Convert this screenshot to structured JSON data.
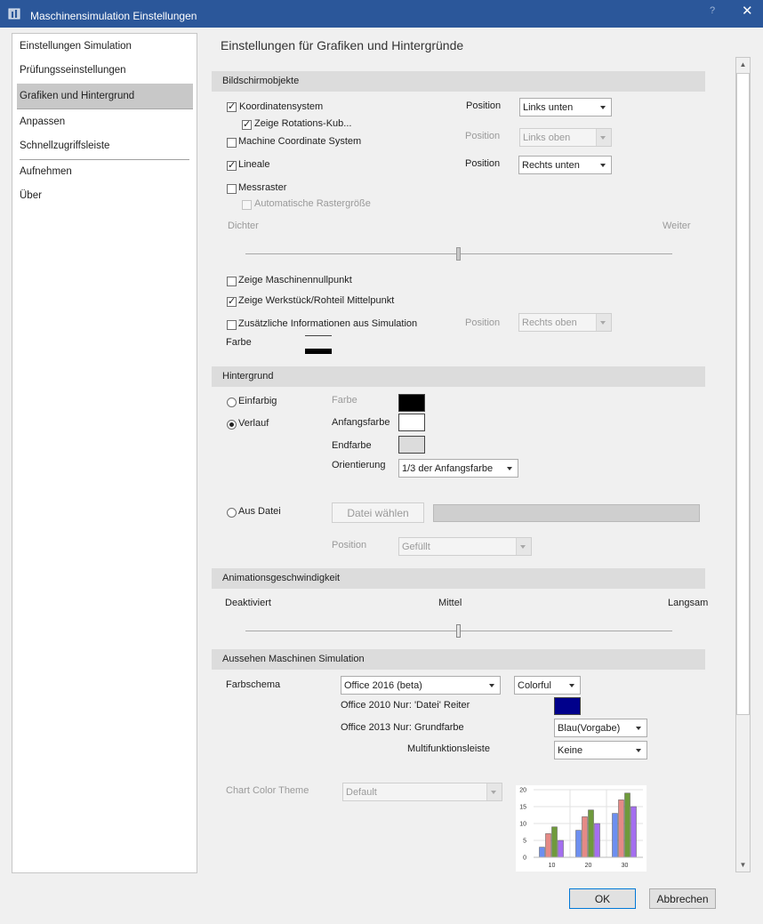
{
  "window": {
    "title": "Maschinensimulation Einstellungen",
    "help_label": "?",
    "close_label": "✕"
  },
  "nav": {
    "items": [
      {
        "label": "Einstellungen Simulation"
      },
      {
        "label": "Prüfungsseinstellungen"
      },
      {
        "label": "Grafiken und Hintergrund",
        "selected": true
      },
      {
        "label": "Anpassen"
      },
      {
        "label": "Schnellzugriffsleiste"
      },
      {
        "label": "Aufnehmen"
      },
      {
        "label": "Über"
      }
    ]
  },
  "page_title": "Einstellungen für Grafiken und Hintergründe",
  "bildschirm": {
    "header": "Bildschirmobjekte",
    "koordinatensystem": {
      "label": "Koordinatensystem",
      "checked": true,
      "position_label": "Position",
      "position_value": "Links unten"
    },
    "rotations": {
      "label": "Zeige Rotations-Kub...",
      "checked": true
    },
    "machine_coord": {
      "label": "Machine Coordinate System",
      "checked": false,
      "position_label": "Position",
      "position_value": "Links oben"
    },
    "lineale": {
      "label": "Lineale",
      "checked": true,
      "position_label": "Position",
      "position_value": "Rechts unten"
    },
    "messraster": {
      "label": "Messraster",
      "checked": false
    },
    "auto_raster": {
      "label": "Automatische Rastergröße",
      "checked": false
    },
    "slider_left": "Dichter",
    "slider_right": "Weiter",
    "maschinennull": {
      "label": "Zeige Maschinennullpunkt",
      "checked": false
    },
    "werkstueck": {
      "label": "Zeige Werkstück/Rohteil Mittelpunkt",
      "checked": true
    },
    "zusatz": {
      "label": "Zusätzliche Informationen aus Simulation",
      "checked": false,
      "position_label": "Position",
      "position_value": "Rechts oben"
    },
    "farbe_label": "Farbe"
  },
  "hintergrund": {
    "header": "Hintergrund",
    "einfarbig": {
      "label": "Einfarbig",
      "selected": false
    },
    "verlauf": {
      "label": "Verlauf",
      "selected": true
    },
    "farbe_label": "Farbe",
    "farbe_color": "#000000",
    "anfangsfarbe_label": "Anfangsfarbe",
    "anfangsfarbe_color": "#ffffff",
    "endfarbe_label": "Endfarbe",
    "endfarbe_color": "#dcdcdc",
    "orientierung_label": "Orientierung",
    "orientierung_value": "1/3 der Anfangsfarbe",
    "aus_datei": {
      "label": "Aus Datei",
      "selected": false
    },
    "datei_button": "Datei wählen",
    "position_label": "Position",
    "position_value": "Gefüllt"
  },
  "animation": {
    "header": "Animationsgeschwindigkeit",
    "left": "Deaktiviert",
    "middle": "Mittel",
    "right": "Langsam",
    "level": 0.5
  },
  "aussehen": {
    "header": "Aussehen Maschinen Simulation",
    "farbschema_label": "Farbschema",
    "farbschema_value": "Office 2016 (beta)",
    "colorful_value": "Colorful",
    "office2010_label": "Office 2010 Nur: 'Datei' Reiter",
    "office2010_color": "#00008b",
    "office2013_label": "Office 2013 Nur: Grundfarbe",
    "office2013_value": "Blau(Vorgabe)",
    "multifunktion_label": "Multifunktionsleiste",
    "multifunktion_value": "Keine",
    "chart_theme_label": "Chart Color Theme",
    "chart_theme_value": "Default"
  },
  "chart_data": {
    "type": "bar",
    "categories": [
      "10",
      "20",
      "30"
    ],
    "y_ticks": [
      "0",
      "5",
      "10",
      "15",
      "20"
    ],
    "ylim": [
      0,
      20
    ],
    "series": [
      {
        "values": [
          3,
          8,
          13
        ],
        "color": "#6d8ff0"
      },
      {
        "values": [
          7,
          12,
          17
        ],
        "color": "#e58a86"
      },
      {
        "values": [
          9,
          14,
          19
        ],
        "color": "#6f9a3c"
      },
      {
        "values": [
          5,
          10,
          15
        ],
        "color": "#a46ef0"
      }
    ]
  },
  "buttons": {
    "ok": "OK",
    "cancel": "Abbrechen"
  },
  "accent": "#2b579a"
}
